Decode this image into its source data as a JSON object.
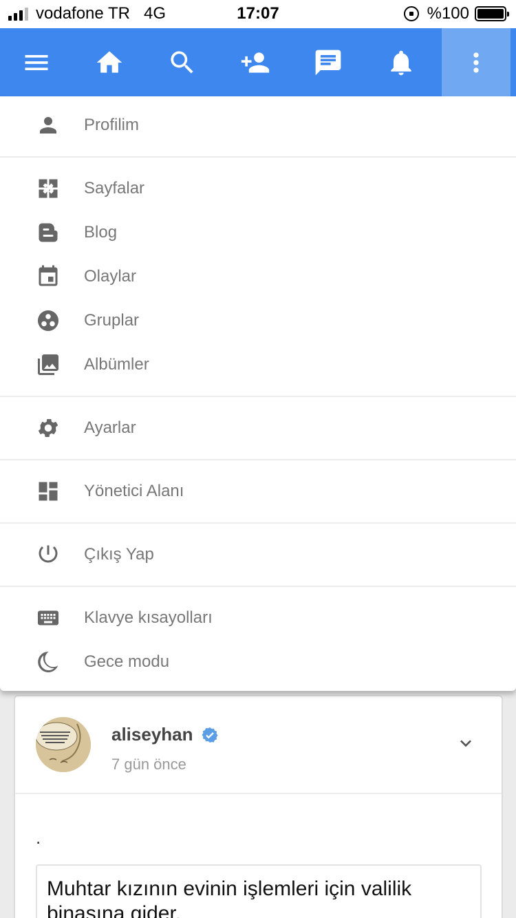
{
  "status_bar": {
    "carrier": "vodafone TR",
    "network": "4G",
    "time": "17:07",
    "battery": "%100"
  },
  "app_bar": {
    "accent_color": "#3d87ee",
    "buttons": [
      {
        "icon": "menu-icon"
      },
      {
        "icon": "home-icon"
      },
      {
        "icon": "search-icon"
      },
      {
        "icon": "add-friend-icon"
      },
      {
        "icon": "messages-icon"
      },
      {
        "icon": "notifications-icon"
      },
      {
        "icon": "more-vert-icon",
        "active": true
      }
    ]
  },
  "menu": {
    "items": [
      {
        "icon": "person-icon",
        "label": "Profilim"
      },
      {
        "icon": "pages-icon",
        "label": "Sayfalar"
      },
      {
        "icon": "blog-icon",
        "label": "Blog"
      },
      {
        "icon": "calendar-icon",
        "label": "Olaylar"
      },
      {
        "icon": "groups-icon",
        "label": "Gruplar"
      },
      {
        "icon": "albums-icon",
        "label": "Albümler"
      },
      {
        "icon": "gear-icon",
        "label": "Ayarlar"
      },
      {
        "icon": "dashboard-icon",
        "label": "Yönetici Alanı"
      },
      {
        "icon": "power-icon",
        "label": "Çıkış Yap"
      },
      {
        "icon": "keyboard-icon",
        "label": "Klavye kısayolları"
      },
      {
        "icon": "moon-icon",
        "label": "Gece modu"
      }
    ]
  },
  "post": {
    "username": "aliseyhan",
    "verified_color": "#5b9ee6",
    "time": "7 gün önce",
    "text": ".",
    "quote": "Muhtar kızının evinin işlemleri için valilik binasına gider."
  }
}
